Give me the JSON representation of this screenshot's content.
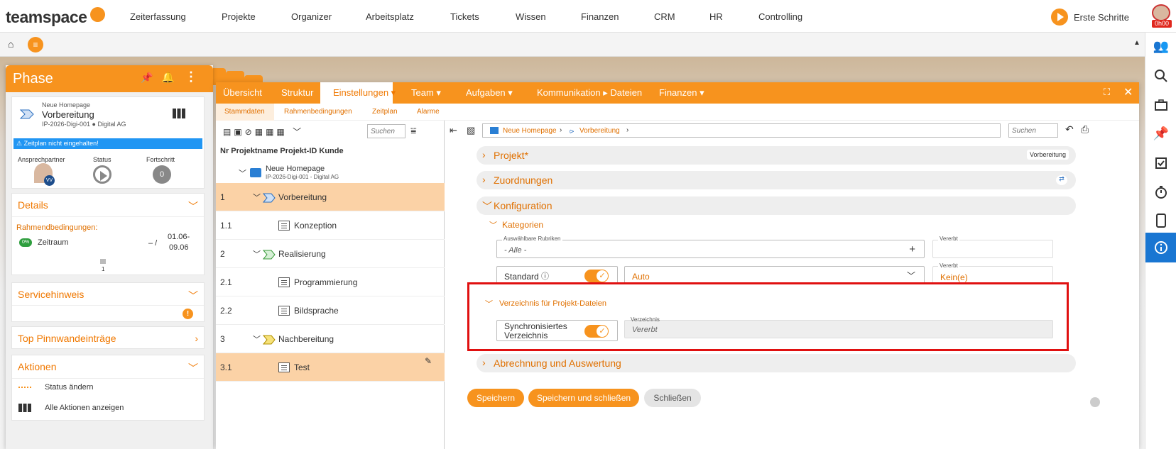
{
  "topbar": {
    "logo": "teamspace",
    "nav": [
      "Zeiterfassung",
      "Projekte",
      "Organizer",
      "Arbeitsplatz",
      "Tickets",
      "Wissen",
      "Finanzen",
      "CRM",
      "HR",
      "Controlling"
    ],
    "start": "Erste Schritte",
    "timer": "0h00"
  },
  "sub": {
    "home": "⌂",
    "menu": "≡",
    "collapse": "▲"
  },
  "phase": {
    "title": "Phase",
    "project": "Neue Homepage",
    "phase_name": "Vorbereitung",
    "id_line": "IP-2026-Digi-001 ● Digital AG",
    "warning": "Zeitplan nicht eingehalten!",
    "contact_label": "Ansprechpartner",
    "status_label": "Status",
    "progress_label": "Fortschritt",
    "progress_value": "0",
    "avatar_badge": "VV",
    "details": {
      "title": "Details",
      "rahmen": "Rahmendbedingungen:",
      "badge": "0%",
      "zeitraum": "Zeitraum",
      "dash": "– /",
      "d1": "01.06-",
      "d2": "09.06",
      "count": "1"
    },
    "service": "Servicehinweis",
    "service_badge": "!",
    "pinn": "Top Pinnwandeinträge",
    "aktionen": "Aktionen",
    "status_aendern": "Status ändern",
    "alle": "Alle Aktionen anzeigen"
  },
  "tabs": [
    "Übersicht",
    "Struktur",
    "Einstellungen ▾",
    "Team ▾",
    "Aufgaben ▾",
    "Kommunikation ▸ Dateien",
    "Finanzen ▾"
  ],
  "subtabs": [
    "Stammdaten",
    "Rahmenbedingungen",
    "Zeitplan",
    "Alarme"
  ],
  "tree": {
    "search_placeholder": "Suchen",
    "header": "Nr  Projektname Projekt-ID Kunde",
    "root_name": "Neue Homepage",
    "root_sub": "IP-2026-Digi-001 - Digital AG",
    "rows": [
      {
        "nr": "1",
        "name": "Vorbereitung"
      },
      {
        "nr": "1.1",
        "name": "Konzeption"
      },
      {
        "nr": "2",
        "name": "Realisierung"
      },
      {
        "nr": "2.1",
        "name": "Programmierung"
      },
      {
        "nr": "2.2",
        "name": "Bildsprache"
      },
      {
        "nr": "3",
        "name": "Nachbereitung"
      },
      {
        "nr": "3.1",
        "name": "Test"
      }
    ]
  },
  "detail": {
    "crumb1": "Neue Homepage",
    "crumb2": "Vorbereitung",
    "search_placeholder": "Suchen",
    "projekt": "Projekt*",
    "projekt_badge": "Vorbereitung",
    "zuord": "Zuordnungen",
    "konfig": "Konfiguration",
    "kat": "Kategorien",
    "rubriken_label": "Auswählbare Rubriken",
    "rubriken_value": "- Alle -",
    "vererbt1": "Vererbt",
    "standard": "Standard",
    "auto": "Auto",
    "vererbt2": "Vererbt",
    "kein": "Kein(e)",
    "verz_title": "Verzeichnis für Projekt-Dateien",
    "sync1": "Synchronisiertes",
    "sync2": "Verzeichnis",
    "verz_label": "Verzeichnis",
    "verz_value": "Vererbt",
    "abrechnung": "Abrechnung und Auswertung",
    "save": "Speichern",
    "save_close": "Speichern und schließen",
    "close": "Schließen"
  },
  "colors": {
    "accent": "#f7931e",
    "highlight_red": "#e01010"
  }
}
